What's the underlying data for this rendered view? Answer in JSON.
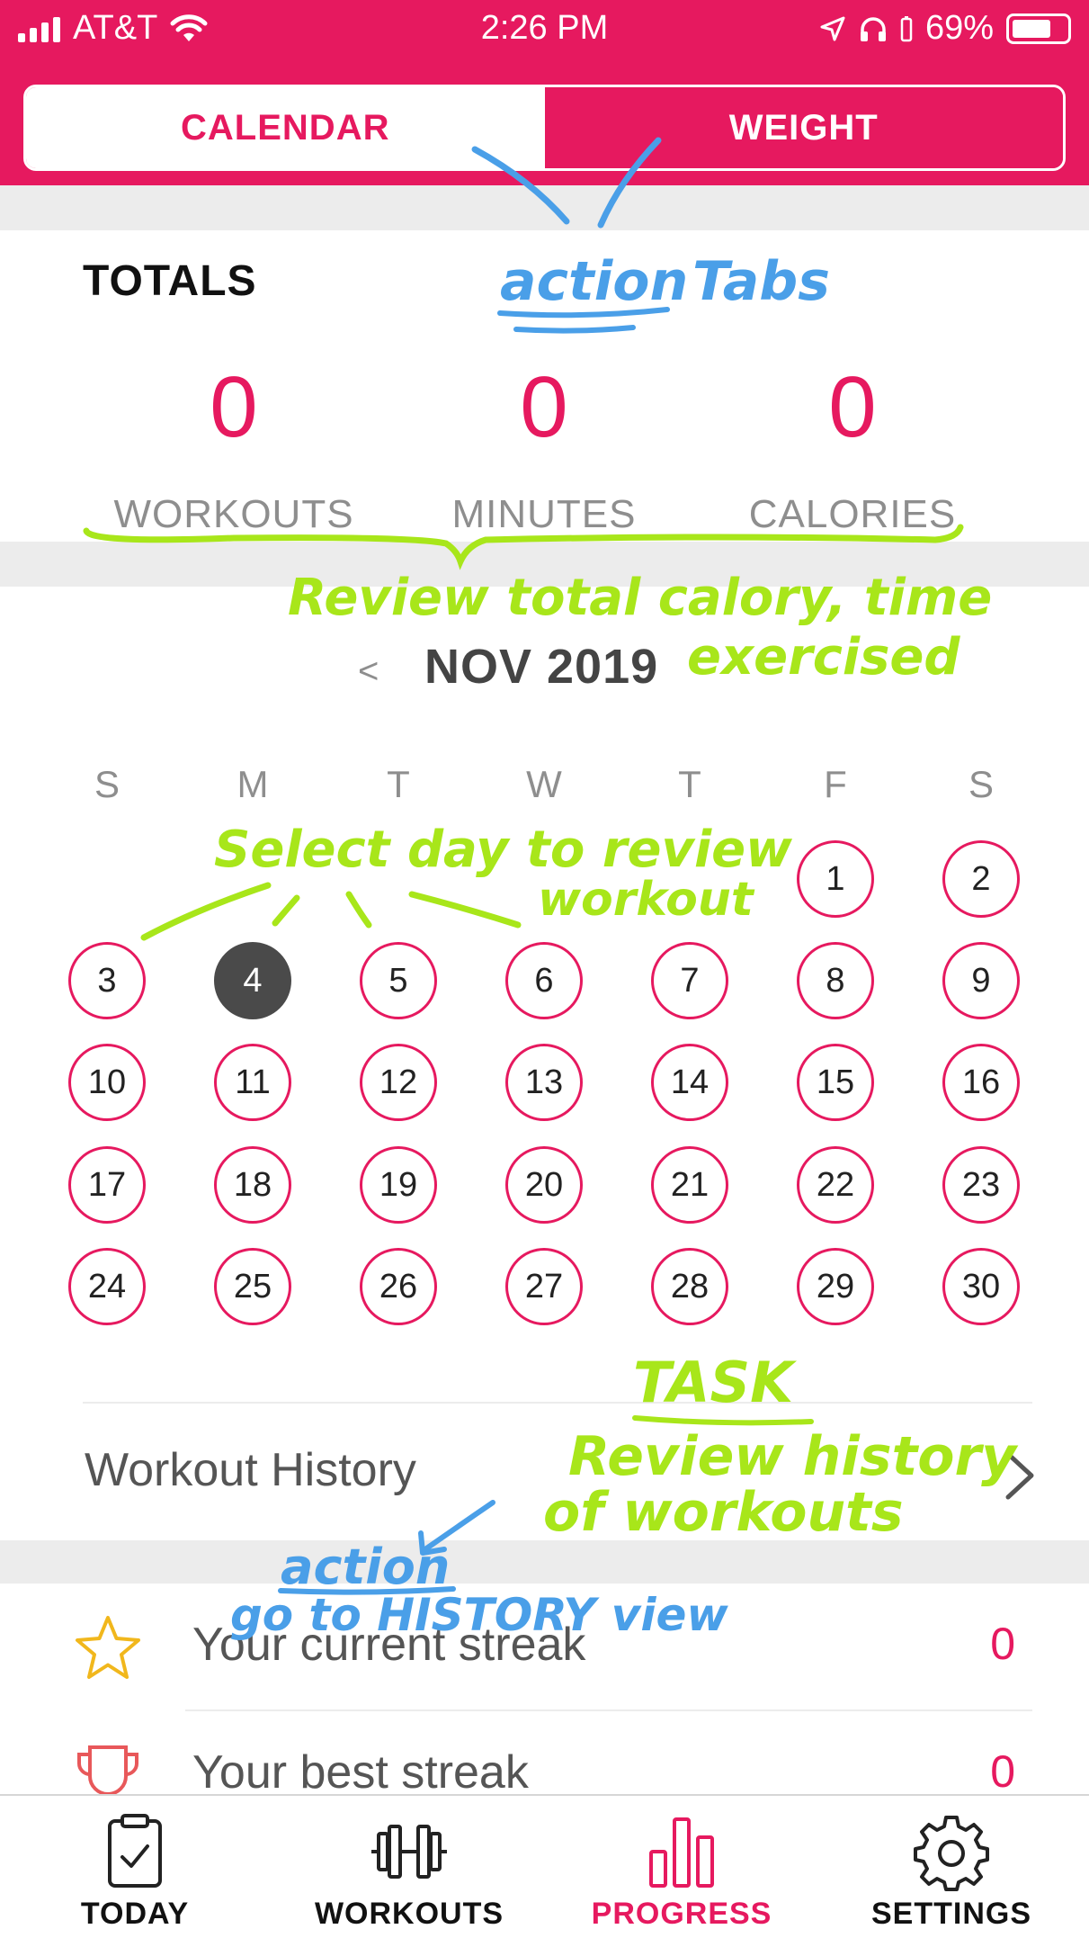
{
  "status_bar": {
    "carrier": "AT&T",
    "time": "2:26 PM",
    "battery": "69%"
  },
  "tabs": [
    {
      "label": "CALENDAR",
      "active": true
    },
    {
      "label": "WEIGHT",
      "active": false
    }
  ],
  "totals": {
    "title": "TOTALS",
    "stats": [
      {
        "value": "0",
        "label": "WORKOUTS"
      },
      {
        "value": "0",
        "label": "MINUTES"
      },
      {
        "value": "0",
        "label": "CALORIES"
      }
    ]
  },
  "calendar": {
    "prev_symbol": "<",
    "month_label": "NOV 2019",
    "weekdays": [
      "S",
      "M",
      "T",
      "W",
      "T",
      "F",
      "S"
    ],
    "selected_day": "4",
    "weeks": [
      [
        "",
        "",
        "",
        "",
        "",
        "1",
        "2"
      ],
      [
        "3",
        "4",
        "5",
        "6",
        "7",
        "8",
        "9"
      ],
      [
        "10",
        "11",
        "12",
        "13",
        "14",
        "15",
        "16"
      ],
      [
        "17",
        "18",
        "19",
        "20",
        "21",
        "22",
        "23"
      ],
      [
        "24",
        "25",
        "26",
        "27",
        "28",
        "29",
        "30"
      ]
    ]
  },
  "history": {
    "label": "Workout History"
  },
  "streaks": [
    {
      "label": "Your current streak",
      "value": "0",
      "icon": "star-icon"
    },
    {
      "label": "Your best streak",
      "value": "0",
      "icon": "trophy-icon"
    }
  ],
  "bottom_nav": [
    {
      "label": "TODAY",
      "icon": "clipboard-check-icon",
      "active": false
    },
    {
      "label": "WORKOUTS",
      "icon": "dumbbell-icon",
      "active": false
    },
    {
      "label": "PROGRESS",
      "icon": "bar-chart-icon",
      "active": true
    },
    {
      "label": "SETTINGS",
      "icon": "gear-icon",
      "active": false
    }
  ],
  "annotations": {
    "action_tabs_word": "action",
    "action_tabs_rest": "Tabs",
    "review_totals_line1": "Review total calory, time",
    "review_totals_line2": "exercised",
    "select_day_line1": "Select day to review",
    "select_day_line2": "workout",
    "task_title": "TASK",
    "task_line1": "Review history",
    "task_line2": "of workouts",
    "action_history_word": "action",
    "action_history_rest": "go to HISTORY view"
  },
  "colors": {
    "accent": "#e6195f",
    "annotation_blue": "#4a9fe8",
    "annotation_green": "#a8e61a",
    "selected_day": "#4a4a4a",
    "muted_text": "#8e8e8e"
  }
}
